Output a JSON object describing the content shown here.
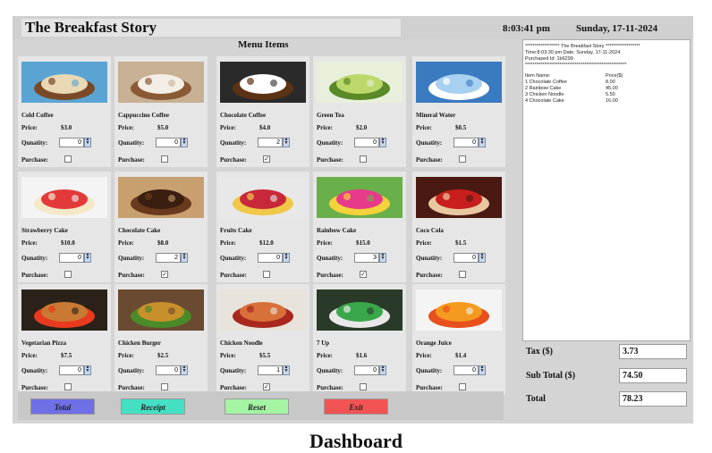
{
  "app": {
    "title": "The Breakfast Story",
    "time": "8:03:41 pm",
    "date": "Sunday, 17-11-2024",
    "menu_heading": "Menu Items"
  },
  "labels": {
    "price": "Price:",
    "quantity": "Qunatity:",
    "purchase": "Purchase:"
  },
  "items": [
    {
      "name": "Cold Coffee",
      "price": "$3.0",
      "qty": "0",
      "purchased": false
    },
    {
      "name": "Cappuccino Coffee",
      "price": "$5.0",
      "qty": "0",
      "purchased": false
    },
    {
      "name": "Chocolate Coffee",
      "price": "$4.0",
      "qty": "2",
      "purchased": true
    },
    {
      "name": "Green Tea",
      "price": "$2.0",
      "qty": "0",
      "purchased": false
    },
    {
      "name": "Mineral Water",
      "price": "$0.5",
      "qty": "0",
      "purchased": false
    },
    {
      "name": "Strawberry Cake",
      "price": "$10.0",
      "qty": "0",
      "purchased": false
    },
    {
      "name": "Chocolate Cake",
      "price": "$8.0",
      "qty": "2",
      "purchased": true
    },
    {
      "name": "Fruits Cake",
      "price": "$12.0",
      "qty": "0",
      "purchased": false
    },
    {
      "name": "Rainbow Cake",
      "price": "$15.0",
      "qty": "3",
      "purchased": true
    },
    {
      "name": "Coco Cola",
      "price": "$1.5",
      "qty": "0",
      "purchased": false
    },
    {
      "name": "Vegetarian Pizza",
      "price": "$7.5",
      "qty": "0",
      "purchased": false
    },
    {
      "name": "Chicken Burger",
      "price": "$2.5",
      "qty": "0",
      "purchased": false
    },
    {
      "name": "Chicken Noodle",
      "price": "$5.5",
      "qty": "1",
      "purchased": true
    },
    {
      "name": "7 Up",
      "price": "$1.6",
      "qty": "0",
      "purchased": false
    },
    {
      "name": "Orange Juice",
      "price": "$1.4",
      "qty": "0",
      "purchased": false
    }
  ],
  "buttons": {
    "total": "Total",
    "receipt": "Receipt",
    "reset": "Reset",
    "exit": "Exit"
  },
  "button_colors": {
    "total": "#6f6fe6",
    "receipt": "#44e0c4",
    "reset": "#a4f4a4",
    "exit": "#f25454"
  },
  "receipt": {
    "header": "****************** The Breakfast Story ******************",
    "line1": "Time:8:03:30 pm Date: Sunday, 17-11-2024",
    "line2": "Purchased Id: 1b6299",
    "divider": "*****************************************************",
    "col_item": "Item Name:",
    "col_price": "Price($)",
    "rows": [
      {
        "name": "1  Chocolate Coffee",
        "price": "8.00"
      },
      {
        "name": "2  Rainbow Cake",
        "price": "45.00"
      },
      {
        "name": "3  Chicken Noodle",
        "price": "5.50"
      },
      {
        "name": "4  Chocolate Cake",
        "price": "16.00"
      }
    ]
  },
  "summary": {
    "tax_label": "Tax ($)",
    "tax": "3.73",
    "subtotal_label": "Sub Total ($)",
    "subtotal": "74.50",
    "total_label": "Total",
    "total": "78.23"
  },
  "caption": "Dashboard"
}
